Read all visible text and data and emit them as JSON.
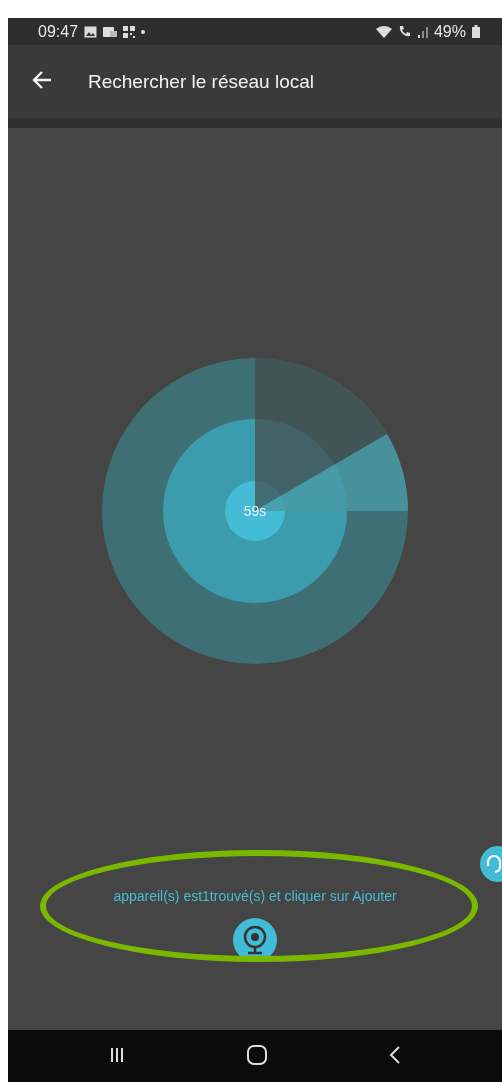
{
  "status_bar": {
    "time": "09:47",
    "battery": "49%"
  },
  "app_bar": {
    "title": "Rechercher le réseau local"
  },
  "radar": {
    "countdown": "59s"
  },
  "hint": "appareil(s) est1trouvé(s) et cliquer sur Ajouter",
  "annotation": {
    "kind": "ellipse",
    "color": "#7ab800"
  }
}
